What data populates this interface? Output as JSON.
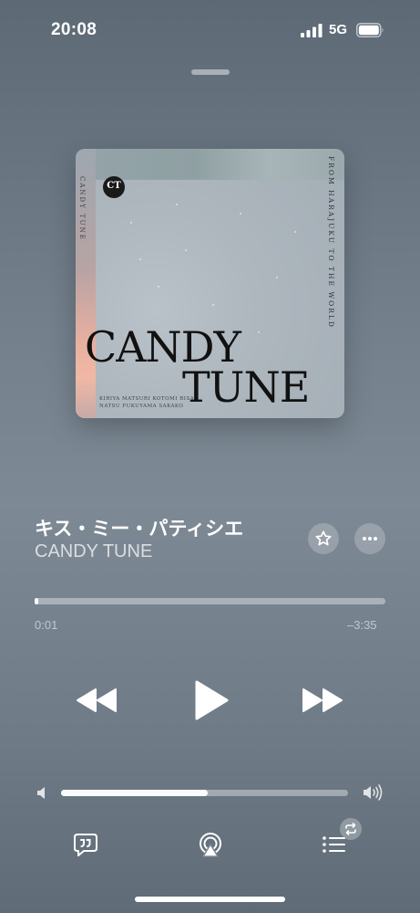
{
  "status_bar": {
    "time": "20:08",
    "network": "5G"
  },
  "album_art": {
    "title_line1": "CANDY",
    "title_line2": "TUNE",
    "side_text_left": "CANDY TUNE",
    "side_text_right": "FROM HARAJUKU TO THE WORLD",
    "logo_text": "CT",
    "members_line1": "KIRIYA MATSURI KOTOMI RISA",
    "members_line2": "NATSU FUKUYAMA SAKAKO"
  },
  "track": {
    "title": "キス・ミー・パティシエ",
    "artist": "CANDY TUNE"
  },
  "progress": {
    "elapsed": "0:01",
    "remaining": "–3:35",
    "fraction": 0.005
  },
  "volume": {
    "fraction": 0.51
  },
  "icons": {
    "favorite": "star-icon",
    "more": "more-icon",
    "rewind": "rewind-icon",
    "play": "play-icon",
    "forward": "fast-forward-icon",
    "volume_low": "volume-low-icon",
    "volume_high": "volume-high-icon",
    "lyrics": "lyrics-icon",
    "airplay": "airplay-icon",
    "queue": "queue-icon",
    "repeat": "repeat-icon"
  }
}
